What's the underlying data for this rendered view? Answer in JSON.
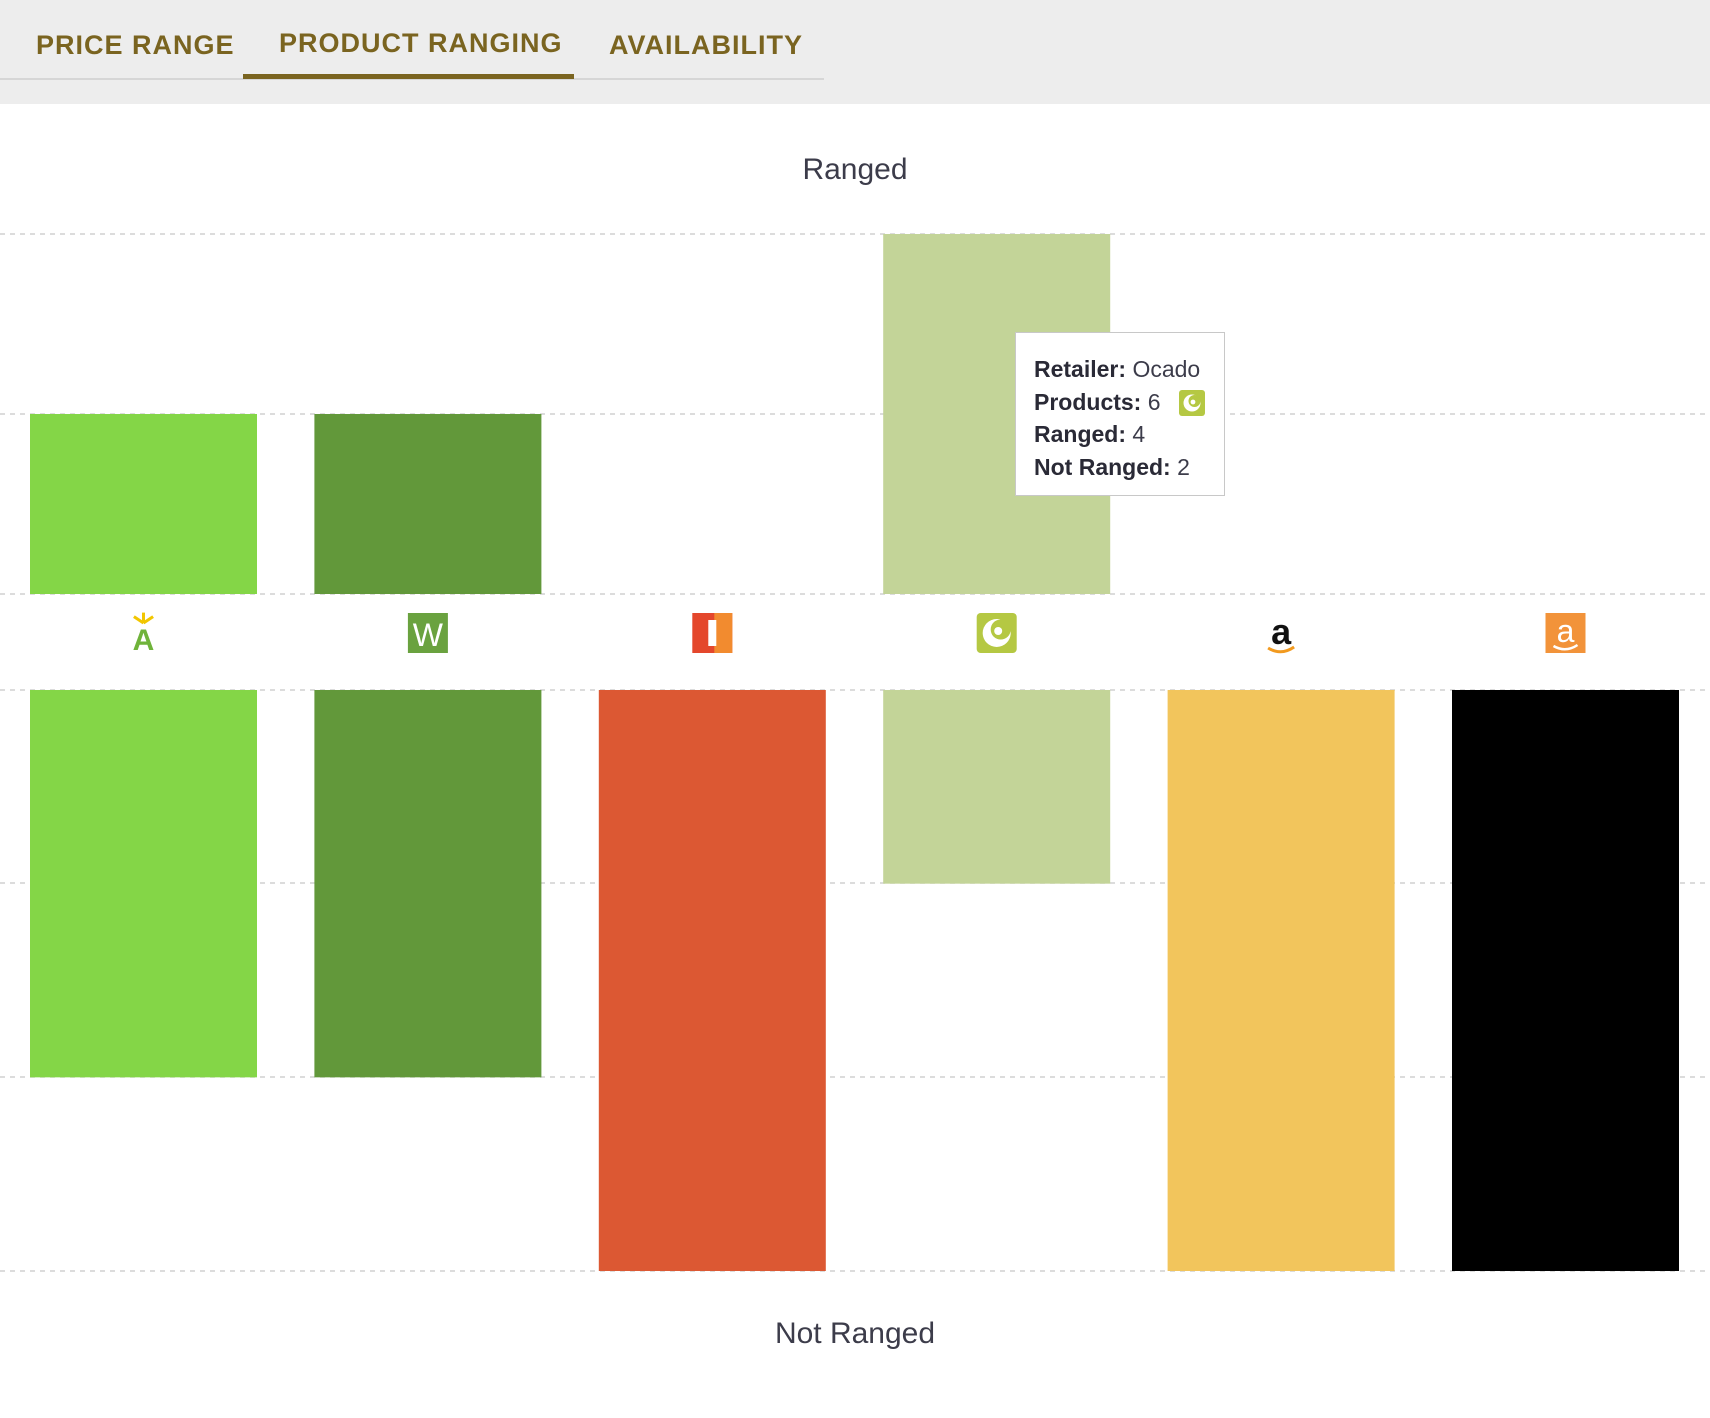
{
  "tabs": [
    {
      "label": "PRICE RANGE"
    },
    {
      "label": "PRODUCT RANGING"
    },
    {
      "label": "AVAILABILITY"
    }
  ],
  "active_tab": "PRODUCT RANGING",
  "colors": {
    "tab_text": "#7a6420",
    "asda": "#84d647",
    "waitrose": "#62983a",
    "iceland": "#dc5833",
    "ocado": "#c3d498",
    "amazon": "#f2c55c",
    "amazon_fresh": "#000000"
  },
  "chart_data": {
    "type": "bar",
    "top_label": "Ranged",
    "bottom_label": "Not Ranged",
    "categories": [
      "Asda",
      "Waitrose",
      "Iceland",
      "Ocado",
      "Amazon",
      "Amazon Fresh"
    ],
    "icons": [
      "asda-icon",
      "waitrose-icon",
      "iceland-icon",
      "ocado-icon",
      "amazon-icon",
      "amazon-fresh-icon"
    ],
    "series": [
      {
        "name": "Ranged",
        "values": [
          2,
          2,
          0,
          4,
          0,
          0
        ]
      },
      {
        "name": "Not Ranged",
        "values": [
          4,
          4,
          6,
          2,
          6,
          6
        ]
      }
    ],
    "ranged_ylim": [
      0,
      4
    ],
    "not_ranged_ylim": [
      0,
      6
    ],
    "grid": true
  },
  "tooltip": {
    "retailer_label": "Retailer:",
    "retailer_value": "Ocado",
    "products_label": "Products:",
    "products_value": "6",
    "ranged_label": "Ranged:",
    "ranged_value": "4",
    "not_ranged_label": "Not Ranged:",
    "not_ranged_value": "2"
  }
}
